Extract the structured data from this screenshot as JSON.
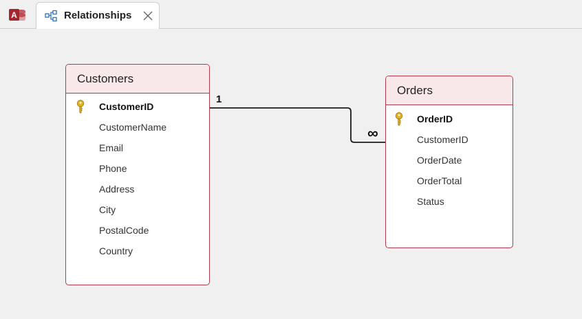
{
  "app": {
    "icon": "access-app-icon",
    "icon_letter": "A",
    "brand_color": "#b7292f"
  },
  "tab": {
    "label": "Relationships",
    "icon": "relationships-icon",
    "close_icon": "close-icon"
  },
  "tables": {
    "customers": {
      "title": "Customers",
      "fields": [
        {
          "label": "CustomerID",
          "primary_key": true
        },
        {
          "label": "CustomerName"
        },
        {
          "label": "Email"
        },
        {
          "label": "Phone"
        },
        {
          "label": "Address"
        },
        {
          "label": "City"
        },
        {
          "label": "PostalCode"
        },
        {
          "label": "Country"
        }
      ]
    },
    "orders": {
      "title": "Orders",
      "fields": [
        {
          "label": "OrderID",
          "primary_key": true
        },
        {
          "label": "CustomerID"
        },
        {
          "label": "OrderDate"
        },
        {
          "label": "OrderTotal"
        },
        {
          "label": "Status"
        }
      ]
    }
  },
  "relationship": {
    "from_table": "Customers",
    "from_field": "CustomerID",
    "to_table": "Orders",
    "to_field": "CustomerID",
    "one_label": "1",
    "many_label": "∞"
  },
  "colors": {
    "table_border": "#b33a4a",
    "table_header_bg": "#f8e8ea",
    "canvas_bg": "#f0f0f0",
    "key_icon": "#e3b21c"
  }
}
